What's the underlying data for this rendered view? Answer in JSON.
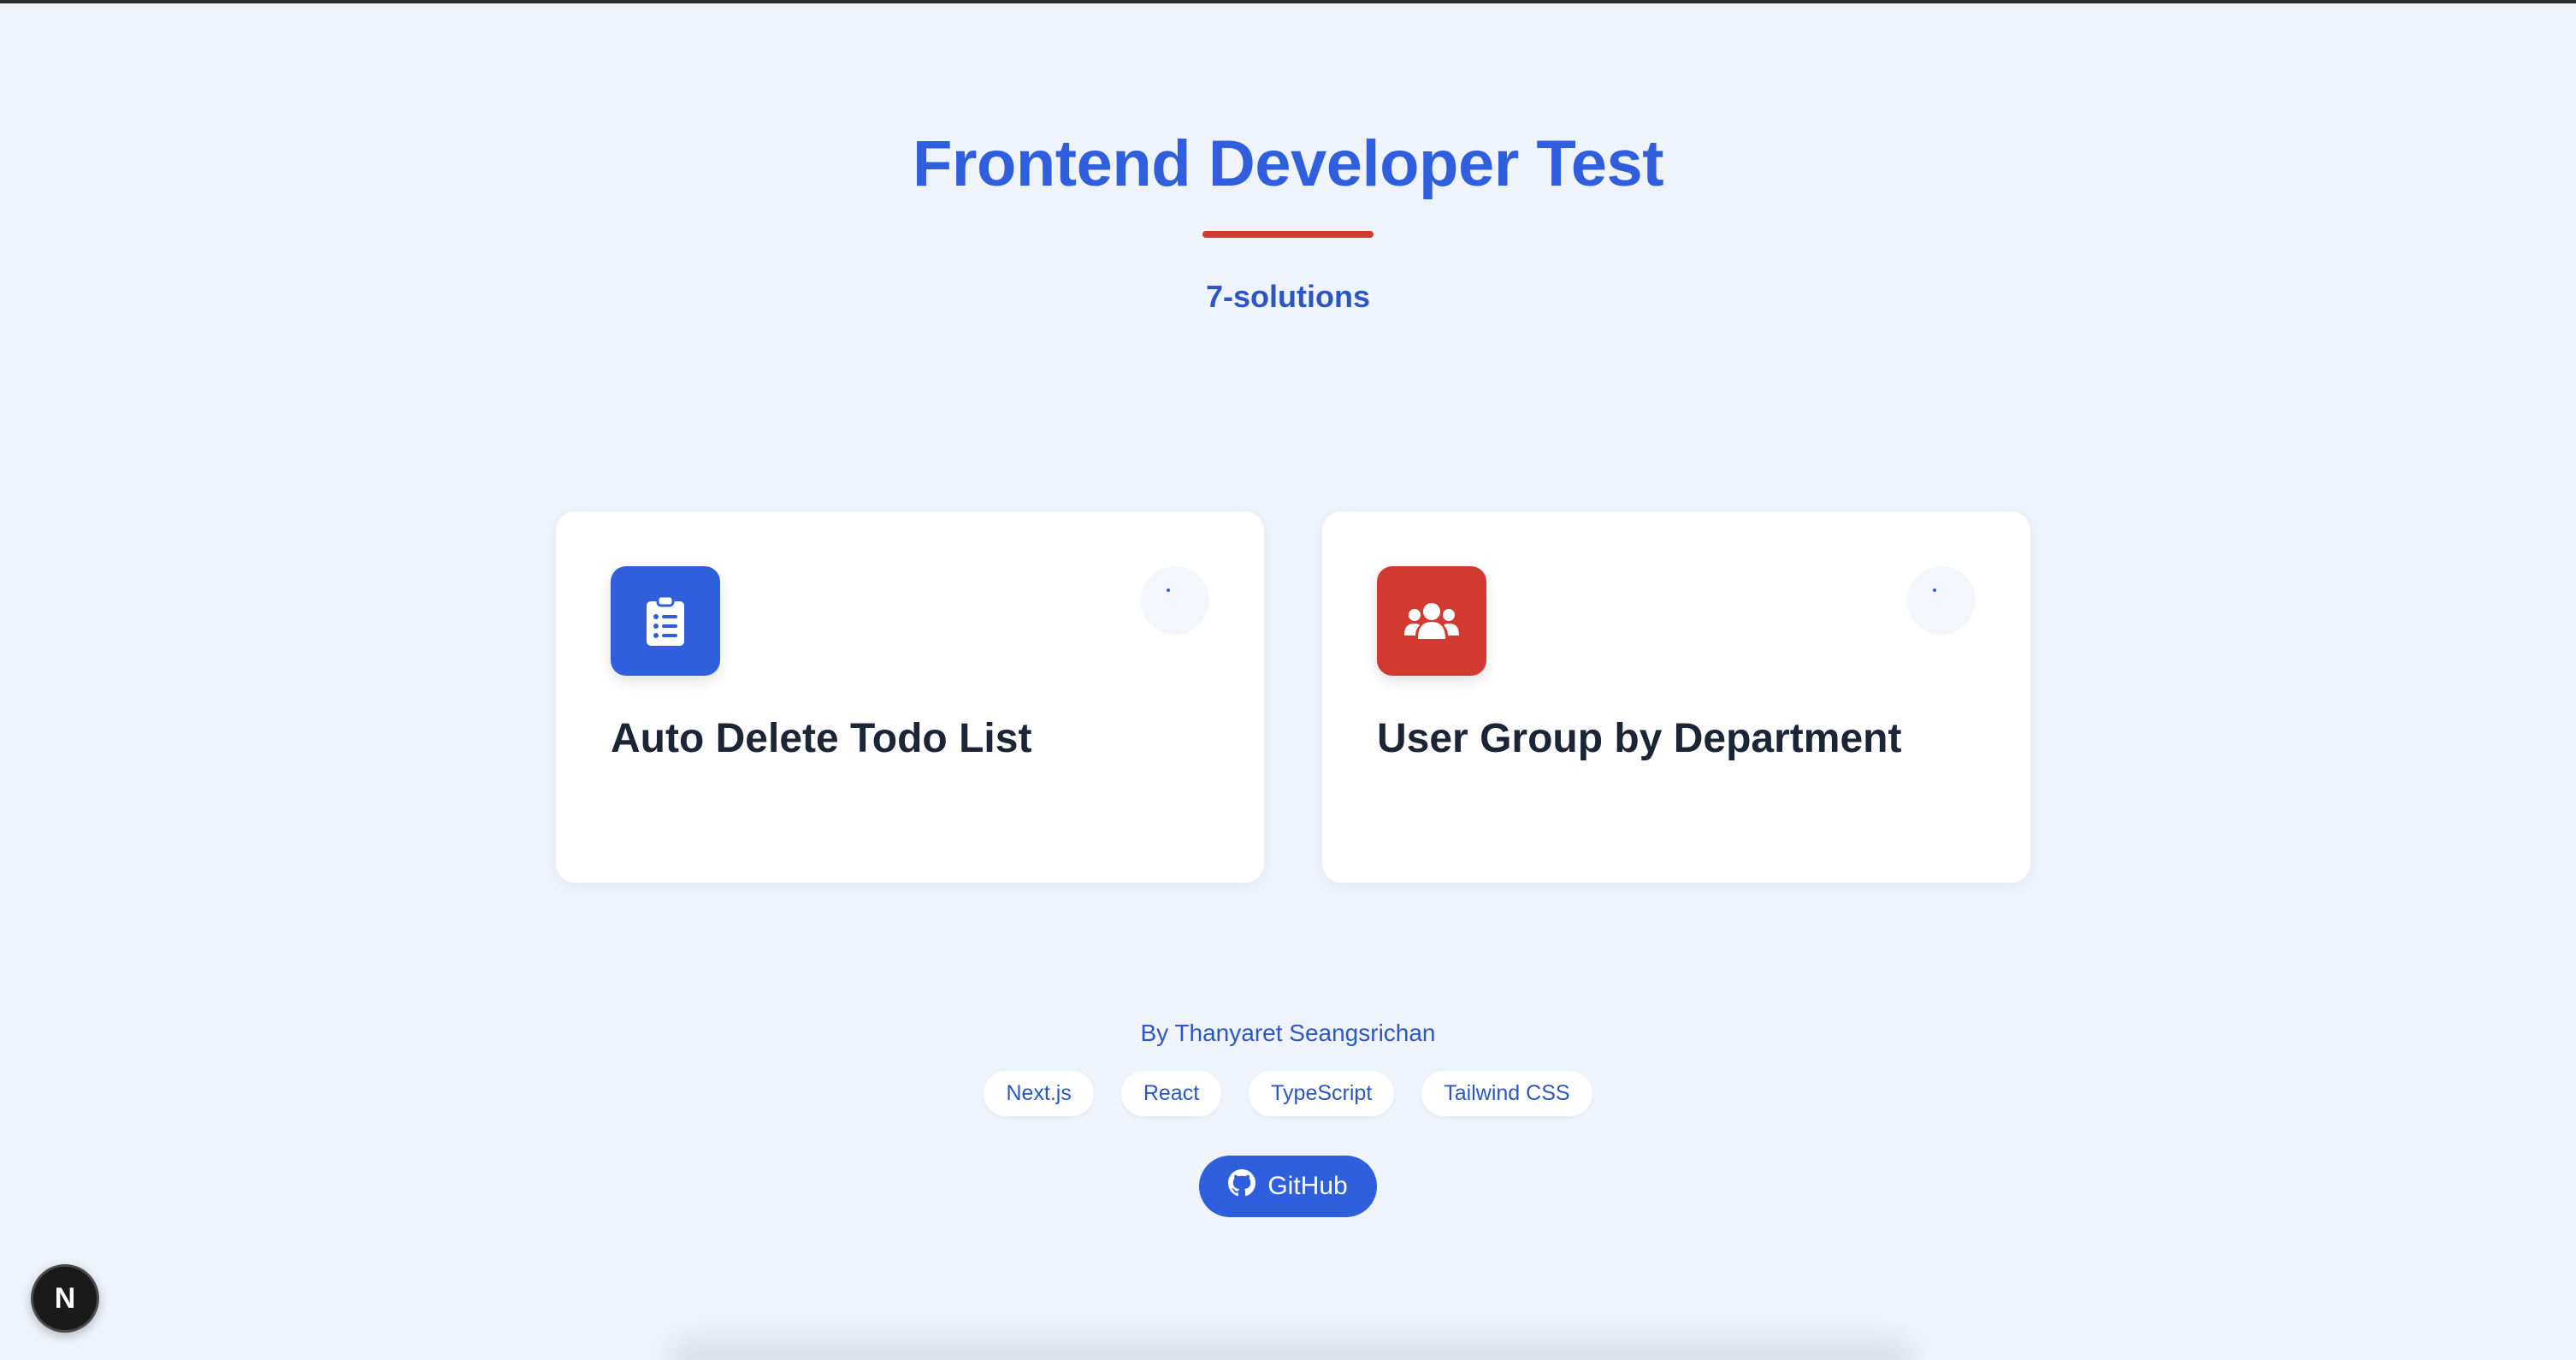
{
  "hero": {
    "title": "Frontend Developer Test",
    "subtitle": "7-solutions"
  },
  "cards": [
    {
      "title": "Auto Delete Todo List",
      "icon": "clipboard-list-icon",
      "color": "#2f5fdc"
    },
    {
      "title": "User Group by Department",
      "icon": "users-icon",
      "color": "#d23a31"
    }
  ],
  "footer": {
    "author": "By Thanyaret Seangsrichan",
    "tags": [
      "Next.js",
      "React",
      "TypeScript",
      "Tailwind CSS"
    ],
    "github_label": "GitHub"
  },
  "dev_badge": {
    "label": "N"
  },
  "colors": {
    "primary": "#2f5fdc",
    "accent": "#d23a31",
    "background": "#eff4fc",
    "text_dark": "#1c2536"
  }
}
